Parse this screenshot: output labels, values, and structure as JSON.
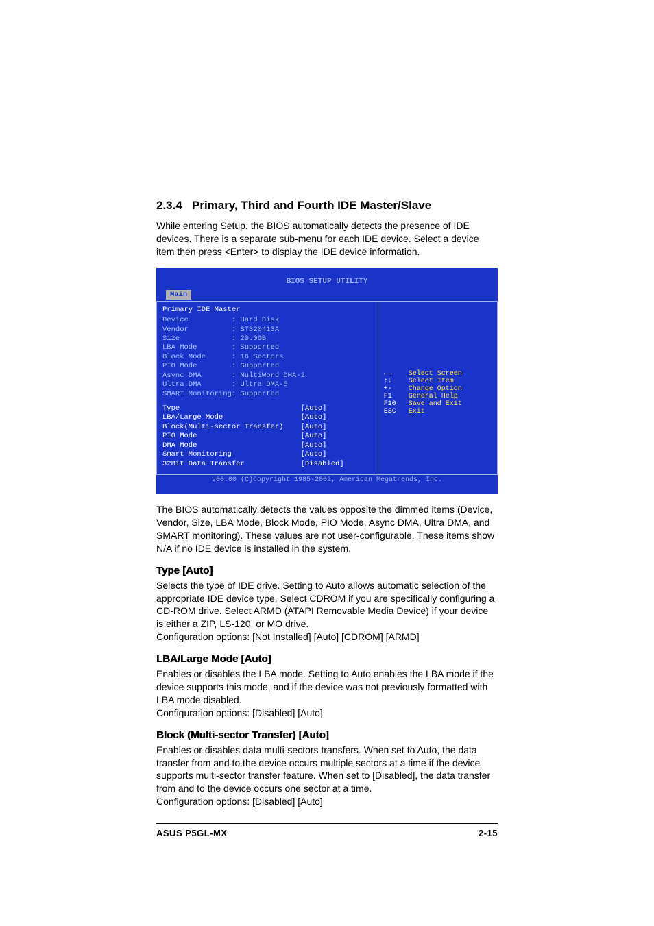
{
  "section": {
    "number": "2.3.4",
    "title": "Primary, Third and Fourth IDE Master/Slave"
  },
  "intro": "While entering Setup, the BIOS automatically detects the presence of IDE devices. There is a separate sub-menu for each IDE device. Select a device item then press <Enter> to display the IDE device information.",
  "bios": {
    "utility_title": "BIOS SETUP UTILITY",
    "tab": "Main",
    "panel_title": "Primary IDE Master",
    "info": [
      {
        "label": "Device",
        "value": "Hard Disk"
      },
      {
        "label": "Vendor",
        "value": "ST320413A"
      },
      {
        "label": "Size",
        "value": "20.0GB"
      },
      {
        "label": "LBA Mode",
        "value": "Supported"
      },
      {
        "label": "Block Mode",
        "value": "16 Sectors"
      },
      {
        "label": "PIO Mode",
        "value": "Supported"
      },
      {
        "label": "Async DMA",
        "value": "MultiWord DMA-2"
      },
      {
        "label": "Ultra DMA",
        "value": "Ultra DMA-5"
      },
      {
        "label": "SMART Monitoring",
        "value": "Supported"
      }
    ],
    "options": [
      {
        "label": "Type",
        "value": "[Auto]"
      },
      {
        "label": "LBA/Large Mode",
        "value": "[Auto]"
      },
      {
        "label": "Block(Multi-sector Transfer)",
        "value": "[Auto]"
      },
      {
        "label": "PIO Mode",
        "value": "[Auto]"
      },
      {
        "label": "DMA Mode",
        "value": "[Auto]"
      },
      {
        "label": "Smart Monitoring",
        "value": "[Auto]"
      },
      {
        "label": "32Bit Data Transfer",
        "value": "[Disabled]"
      }
    ],
    "help": [
      {
        "key": "←→",
        "desc": "Select Screen"
      },
      {
        "key": "↑↓",
        "desc": "Select Item"
      },
      {
        "key": "+-",
        "desc": "Change Option"
      },
      {
        "key": "F1",
        "desc": "General Help"
      },
      {
        "key": "F10",
        "desc": "Save and Exit"
      },
      {
        "key": "ESC",
        "desc": "Exit"
      }
    ],
    "copyright": "v00.00 (C)Copyright 1985-2002, American Megatrends, Inc."
  },
  "after_bios": "The BIOS automatically detects the values opposite the dimmed items (Device, Vendor, Size, LBA Mode, Block Mode, PIO Mode, Async DMA, Ultra DMA, and SMART monitoring). These values are not user-configurable. These items show N/A if no IDE device is installed in the system.",
  "opts": [
    {
      "title": "Type [Auto]",
      "body": "Selects the type of IDE drive. Setting to Auto allows automatic selection of the appropriate IDE device type. Select CDROM if you are specifically configuring a CD-ROM drive. Select ARMD (ATAPI Removable Media Device) if your device is either a ZIP, LS-120, or MO drive.\nConfiguration options: [Not Installed] [Auto] [CDROM] [ARMD]"
    },
    {
      "title": "LBA/Large Mode [Auto]",
      "body": "Enables or disables the LBA mode. Setting to Auto enables the LBA mode if the device supports this mode, and if the device was not previously formatted with LBA mode disabled.\nConfiguration options: [Disabled] [Auto]"
    },
    {
      "title": "Block (Multi-sector Transfer) [Auto]",
      "body": "Enables or disables data multi-sectors transfers. When set to Auto, the data transfer from and to the device occurs multiple sectors at a time if the device supports multi-sector transfer feature. When set to [Disabled], the data transfer from and to the device occurs one sector at a time.\nConfiguration options: [Disabled] [Auto]"
    }
  ],
  "footer": {
    "left": "ASUS P5GL-MX",
    "right": "2-15"
  }
}
